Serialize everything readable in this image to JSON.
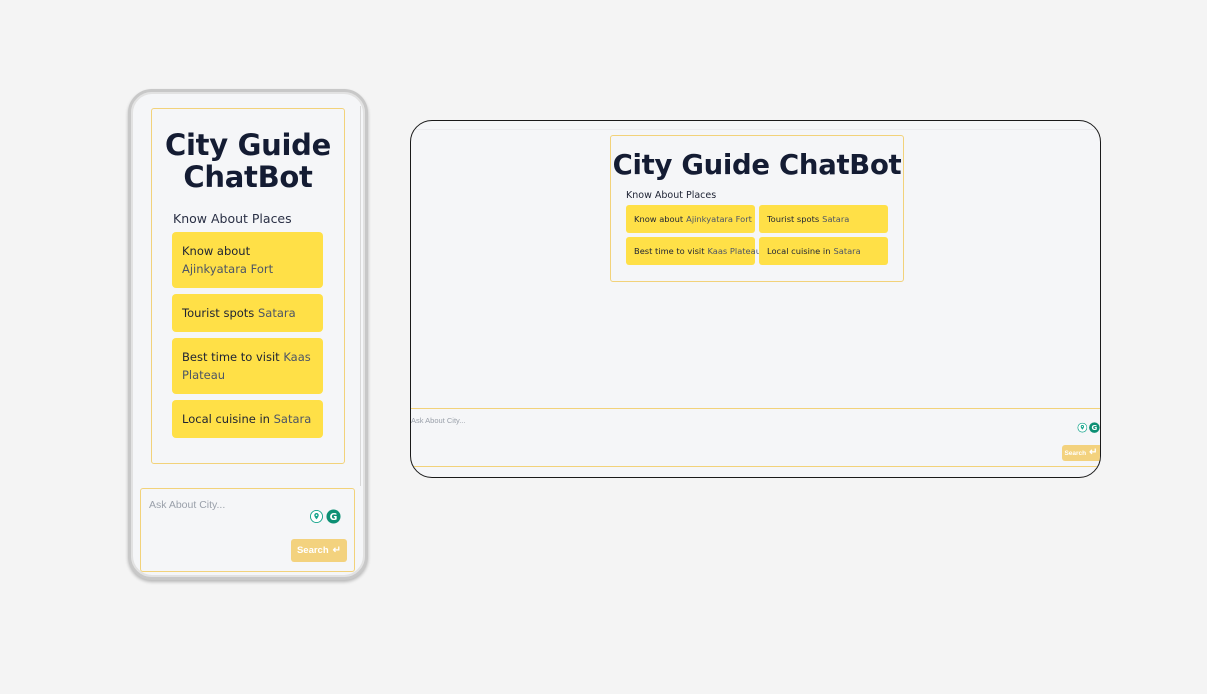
{
  "app": {
    "title": "City Guide ChatBot",
    "subtitle": "Know About Places"
  },
  "suggestions": [
    {
      "prefix": "Know about",
      "highlight": "Ajinkyatara Fort"
    },
    {
      "prefix": "Tourist spots",
      "highlight": "Satara"
    },
    {
      "prefix": "Best time to visit",
      "highlight": "Kaas Plateau"
    },
    {
      "prefix": "Local cuisine in",
      "highlight": "Satara"
    }
  ],
  "input": {
    "placeholder": "Ask About City...",
    "value": ""
  },
  "search_button": {
    "label": "Search",
    "icon": "enter-icon"
  },
  "extensions": [
    {
      "name": "location-pin-icon",
      "color": "#12a38b"
    },
    {
      "name": "grammarly-icon",
      "color": "#0c8f74"
    }
  ],
  "colors": {
    "accent": "#ffe047",
    "border": "#f2d27a",
    "button": "#f3d27e",
    "title": "#141c33",
    "background": "#f4f4f4"
  }
}
